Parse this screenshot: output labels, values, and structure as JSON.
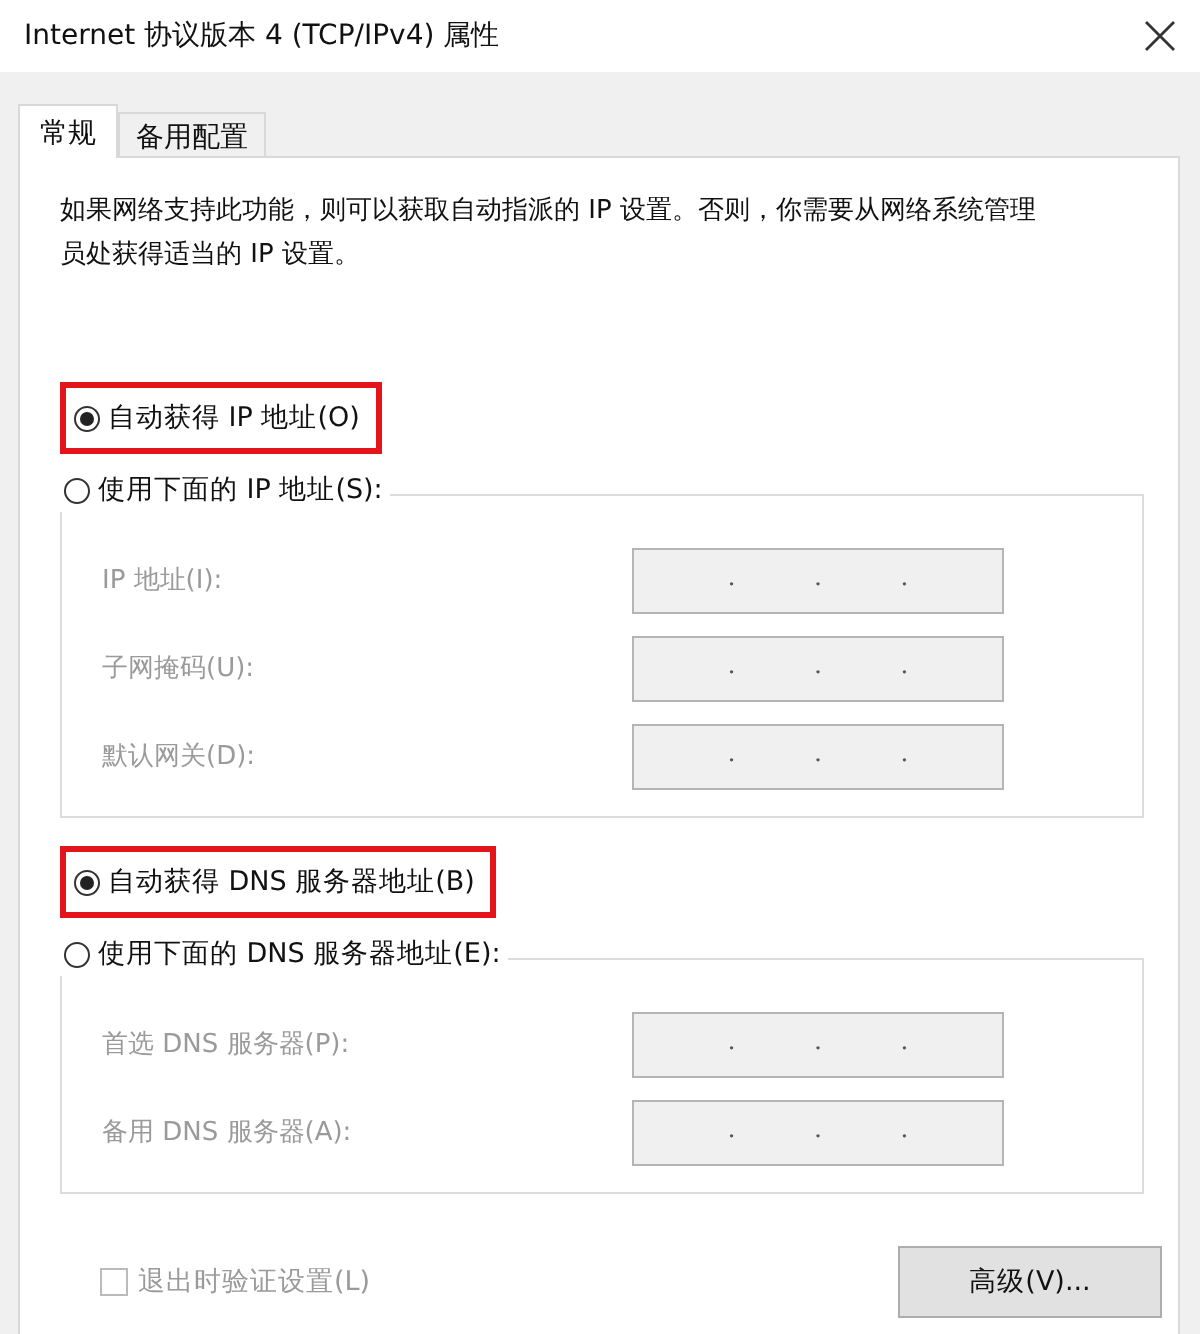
{
  "window": {
    "title": "Internet 协议版本 4 (TCP/IPv4) 属性"
  },
  "tabs": [
    {
      "label": "常规",
      "selected": true
    },
    {
      "label": "备用配置",
      "selected": false
    }
  ],
  "description": "如果网络支持此功能，则可以获取自动指派的 IP 设置。否则，你需要从网络系统管理员处获得适当的 IP 设置。",
  "sections": [
    {
      "auto_option": {
        "label": "自动获得 IP 地址(O)",
        "selected": true,
        "highlighted": true
      },
      "manual_option": {
        "label": "使用下面的 IP 地址(S):",
        "selected": false
      },
      "fields": [
        {
          "label": "IP 地址(I):",
          "disabled": true
        },
        {
          "label": "子网掩码(U):",
          "disabled": true
        },
        {
          "label": "默认网关(D):",
          "disabled": true
        }
      ]
    },
    {
      "auto_option": {
        "label": "自动获得 DNS 服务器地址(B)",
        "selected": true,
        "highlighted": true
      },
      "manual_option": {
        "label": "使用下面的 DNS 服务器地址(E):",
        "selected": false
      },
      "fields": [
        {
          "label": "首选 DNS 服务器(P):",
          "disabled": true
        },
        {
          "label": "备用 DNS 服务器(A):",
          "disabled": true
        }
      ]
    }
  ],
  "validate_checkbox": {
    "label": "退出时验证设置(L)",
    "checked": false,
    "disabled": true
  },
  "advanced_button": {
    "label": "高级(V)..."
  }
}
